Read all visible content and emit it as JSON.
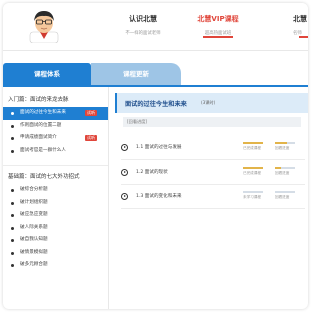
{
  "header": {
    "nav": [
      {
        "title": "认识北慧",
        "sub": "不一样的面试老师"
      },
      {
        "title": "北慧VIP课程",
        "sub": "超高热面试班"
      },
      {
        "title": "北慧",
        "sub": "名师"
      }
    ]
  },
  "tabs": [
    "课程体系",
    "课程更新"
  ],
  "sidebar": {
    "sections": [
      {
        "title": "入门篇：面试的来龙去脉",
        "items": [
          {
            "label": "面试的过往今生和未来",
            "badge": "试听",
            "active": true
          },
          {
            "label": "作则面试的位置二题",
            "badge": "",
            "active": false
          },
          {
            "label": "申请成绩面试简介",
            "badge": "试听",
            "active": false
          },
          {
            "label": "面试考官是一群什么人",
            "badge": "",
            "active": false
          }
        ]
      },
      {
        "title": "基础篇：面试的七大外功招式",
        "items": [
          {
            "label": "破综合分析题"
          },
          {
            "label": "破计划组织题"
          },
          {
            "label": "破应急应变题"
          },
          {
            "label": "破人际关系题"
          },
          {
            "label": "破自我认知题"
          },
          {
            "label": "破情景模拟题"
          },
          {
            "label": "破多元顾合题"
          }
        ]
      }
    ]
  },
  "main": {
    "course_title": "面试的过往今生和未来",
    "course_count": "(3课时)",
    "progress_label": "[回看进度]",
    "lessons": [
      {
        "title": "1.1 面试的过往与发展",
        "p1": 1.0,
        "p2": 0.6,
        "c1": "已完成课程",
        "c2": "回看进度"
      },
      {
        "title": "1.2 面试的现状",
        "p1": 1.0,
        "p2": 0.3,
        "c1": "已完成课程",
        "c2": "回看进度"
      },
      {
        "title": "1.3 面试的变化和未来",
        "p1": 0.0,
        "p2": 0.0,
        "c1": "未学习课程",
        "c2": "回看进度"
      }
    ]
  },
  "colors": {
    "accent": "#1f7fd2",
    "highlight": "#e0463b",
    "progress": "#e2b44a",
    "track": "#d5dde6"
  }
}
